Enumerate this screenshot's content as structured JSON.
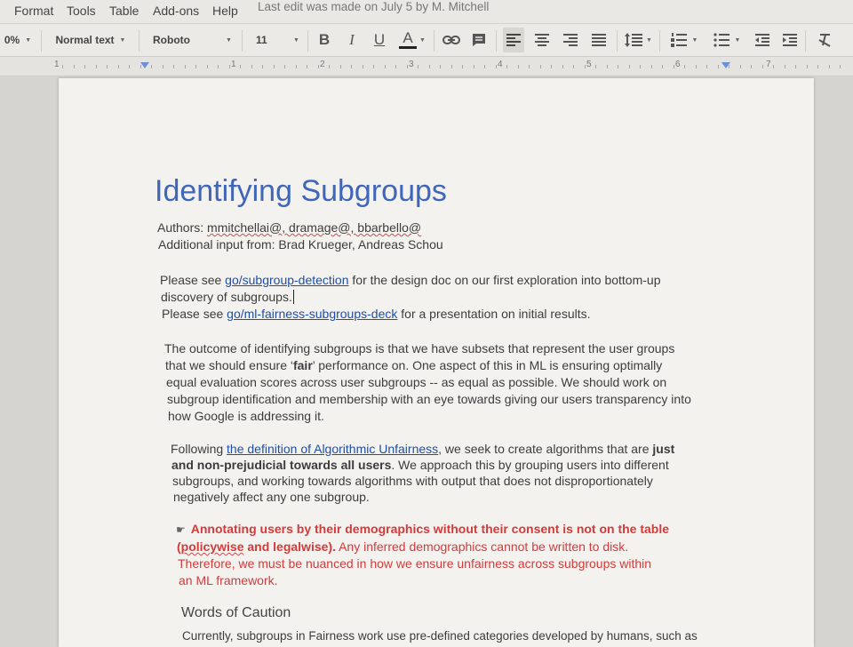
{
  "menu": {
    "items": [
      "Format",
      "Tools",
      "Table",
      "Add-ons",
      "Help"
    ],
    "last_edit": "Last edit was made on July 5 by M. Mitchell"
  },
  "toolbar": {
    "zoom": "0%",
    "style": "Normal text",
    "font": "Roboto",
    "size": "11",
    "bold": "B",
    "italic": "I",
    "underline": "U",
    "text_color": "A"
  },
  "ruler": {
    "numbers": [
      "1",
      "1",
      "2",
      "3",
      "4",
      "5",
      "6",
      "7"
    ]
  },
  "doc": {
    "title": "Identifying Subgroups",
    "authors_label": "Authors:",
    "authors": "mmitchellai@, dramage@, bbarbello@",
    "additional_label": "Additional input from:",
    "additional": "Brad Krueger, Andreas Schou",
    "p1": {
      "a1": "Please see ",
      "link1": "go/subgroup-detection",
      "a2": " for the design doc on our first exploration into bottom-up",
      "a3": "discovery of subgroups.",
      "b1": "Please see ",
      "link2": "go/ml-fairness-subgroups-deck",
      "b2": " for a presentation on initial results."
    },
    "p2": {
      "l1": "The outcome of identifying subgroups is that we have subsets that represent the user groups",
      "l2a": "that we should ensure ‘",
      "l2b": "fair",
      "l2c": "’ performance on.  One aspect of this in ML is ensuring optimally",
      "l3": "equal evaluation scores across user subgroups -- as equal as possible.  We should work on",
      "l4": "subgroup identification and membership with an eye towards giving our users transparency into",
      "l5": "how Google is addressing it."
    },
    "p3": {
      "l1a": "Following ",
      "l1link": "the definition of Algorithmic Unfairness",
      "l1b": ", we seek to create algorithms that are ",
      "l1c": "just",
      "l2a": "and non-prejudicial towards all users",
      "l2b": ".  We approach this by grouping users into different",
      "l3": "subgroups, and working towards algorithms with output that does not disproportionately",
      "l4": "negatively affect any one subgroup."
    },
    "p4": {
      "l1": "Annotating users by their demographics without their consent is not on the table",
      "l2a": "(",
      "l2b": "policywise",
      "l2c": " and legalwise).",
      "l2d": "  Any inferred demographics cannot be written to disk.",
      "l3": "Therefore, we must be nuanced in how we ensure unfairness across subgroups within",
      "l4": "an ML framework."
    },
    "heading2": "Words of Caution",
    "p5": "Currently, subgroups in Fairness work use pre-defined categories developed by humans, such as"
  },
  "colors": {
    "title": "#3f66b8",
    "link": "#1e4fa8",
    "warning": "#d33b3b"
  }
}
